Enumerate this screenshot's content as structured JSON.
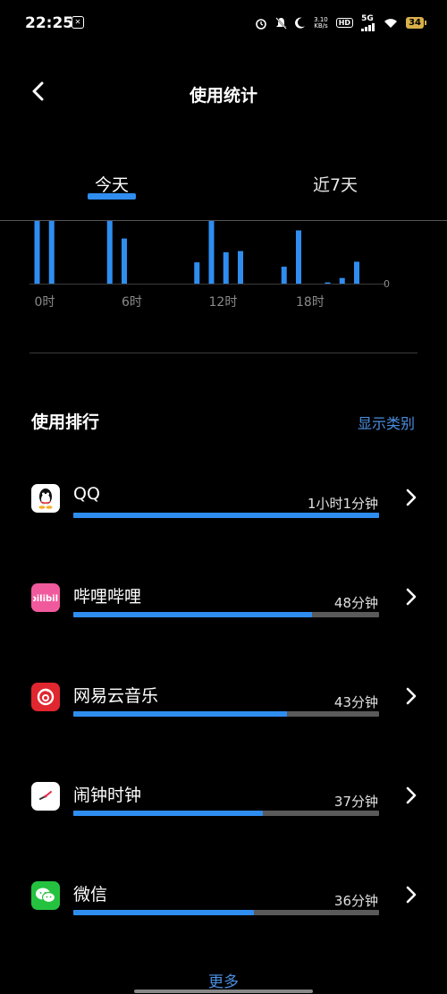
{
  "status_bar": {
    "time": "22:25",
    "net_speed_value": "3.10",
    "net_speed_unit": "KB/s",
    "hd": "HD",
    "network": "5G",
    "battery": "34"
  },
  "header": {
    "title": "使用统计"
  },
  "tabs": [
    {
      "label": "今天",
      "active": true
    },
    {
      "label": "近7天",
      "active": false
    }
  ],
  "chart_data": {
    "type": "bar",
    "x": [
      0,
      1,
      5,
      6,
      11,
      12,
      13,
      14,
      17,
      18,
      20,
      21,
      22
    ],
    "values": [
      100,
      100,
      100,
      72,
      34,
      100,
      50,
      52,
      27,
      85,
      2,
      9,
      35
    ],
    "tick_labels": [
      "0时",
      "6时",
      "12时",
      "18时"
    ],
    "y_label_zero": "0",
    "colors": {
      "bar": "#2f8df0",
      "tick_text": "#8a8a8a",
      "axis": "#3c3c3c"
    }
  },
  "ranking": {
    "title": "使用排行",
    "show_category": "显示类别",
    "items": [
      {
        "name": "QQ",
        "time": "1小时1分钟",
        "fraction": 1.0,
        "icon": "qq-icon",
        "icon_bg": "#ffffff"
      },
      {
        "name": "哔哩哔哩",
        "time": "48分钟",
        "fraction": 0.78,
        "icon": "bilibili-icon",
        "icon_bg": "#f05a9c"
      },
      {
        "name": "网易云音乐",
        "time": "43分钟",
        "fraction": 0.7,
        "icon": "netease-music-icon",
        "icon_bg": "#e0262e"
      },
      {
        "name": "闹钟时钟",
        "time": "37分钟",
        "fraction": 0.62,
        "icon": "clock-icon",
        "icon_bg": "#ffffff"
      },
      {
        "name": "微信",
        "time": "36分钟",
        "fraction": 0.59,
        "icon": "wechat-icon",
        "icon_bg": "#25c240"
      }
    ],
    "more": "更多"
  },
  "colors": {
    "accent": "#2f8df0",
    "link": "#4a8fe0",
    "track": "#5a5a5a"
  }
}
